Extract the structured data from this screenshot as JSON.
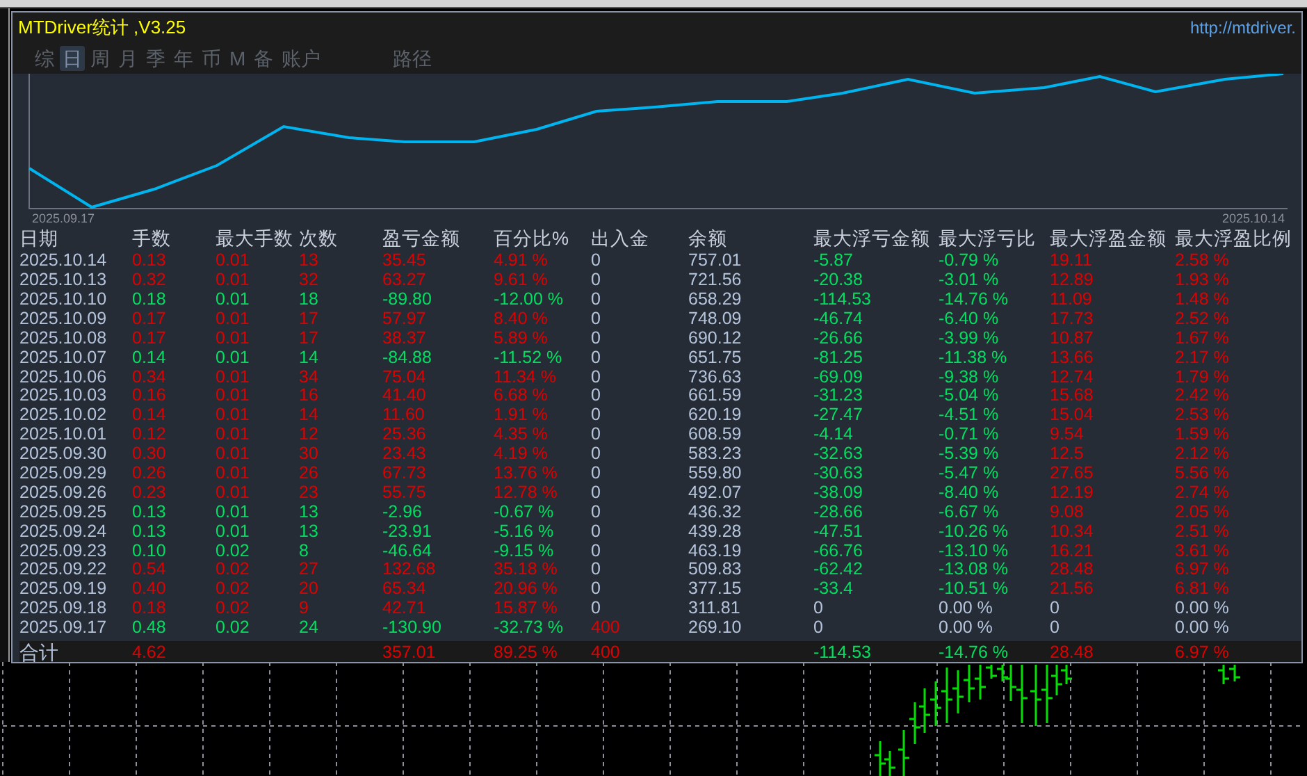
{
  "window": {
    "title": "MTDriver统计 ,V3.25",
    "link": "http://mtdriver."
  },
  "tabs": [
    {
      "label": "综",
      "selected": false
    },
    {
      "label": "日",
      "selected": true
    },
    {
      "label": "周",
      "selected": false
    },
    {
      "label": "月",
      "selected": false
    },
    {
      "label": "季",
      "selected": false
    },
    {
      "label": "年",
      "selected": false
    },
    {
      "label": "币",
      "selected": false
    },
    {
      "label": "M",
      "selected": false
    },
    {
      "label": "备",
      "selected": false
    },
    {
      "label": "账户",
      "selected": false
    },
    {
      "label": "路径",
      "selected": false
    }
  ],
  "balance_chart": {
    "start_label": "2025.09.17",
    "end_label": "2025.10.14"
  },
  "table": {
    "columns": [
      "日期",
      "手数",
      "最大手数",
      "次数",
      "盈亏金额",
      "百分比%",
      "出入金",
      "余额",
      "最大浮亏金额",
      "最大浮亏比",
      "最大浮盈金额",
      "最大浮盈比例"
    ],
    "rows": [
      {
        "cells": [
          {
            "text": "2025.10.14",
            "color": "#b4c4dc"
          },
          {
            "text": "0.13",
            "color": "#e00000"
          },
          {
            "text": "0.01",
            "color": "#e00000"
          },
          {
            "text": "13",
            "color": "#e00000"
          },
          {
            "text": "35.45",
            "color": "#e00000"
          },
          {
            "text": "4.91 %",
            "color": "#e00000"
          },
          {
            "text": "0",
            "color": "#b4c4dc"
          },
          {
            "text": "757.01",
            "color": "#b4c4dc"
          },
          {
            "text": "-5.87",
            "color": "#00e060"
          },
          {
            "text": "-0.79 %",
            "color": "#00e060"
          },
          {
            "text": "19.11",
            "color": "#e00000"
          },
          {
            "text": "2.58 %",
            "color": "#e00000"
          }
        ]
      },
      {
        "cells": [
          {
            "text": "2025.10.13",
            "color": "#b4c4dc"
          },
          {
            "text": "0.32",
            "color": "#e00000"
          },
          {
            "text": "0.01",
            "color": "#e00000"
          },
          {
            "text": "32",
            "color": "#e00000"
          },
          {
            "text": "63.27",
            "color": "#e00000"
          },
          {
            "text": "9.61 %",
            "color": "#e00000"
          },
          {
            "text": "0",
            "color": "#b4c4dc"
          },
          {
            "text": "721.56",
            "color": "#b4c4dc"
          },
          {
            "text": "-20.38",
            "color": "#00e060"
          },
          {
            "text": "-3.01 %",
            "color": "#00e060"
          },
          {
            "text": "12.89",
            "color": "#e00000"
          },
          {
            "text": "1.93 %",
            "color": "#e00000"
          }
        ]
      },
      {
        "cells": [
          {
            "text": "2025.10.10",
            "color": "#b4c4dc"
          },
          {
            "text": "0.18",
            "color": "#00e060"
          },
          {
            "text": "0.01",
            "color": "#00e060"
          },
          {
            "text": "18",
            "color": "#00e060"
          },
          {
            "text": "-89.80",
            "color": "#00e060"
          },
          {
            "text": "-12.00 %",
            "color": "#00e060"
          },
          {
            "text": "0",
            "color": "#b4c4dc"
          },
          {
            "text": "658.29",
            "color": "#b4c4dc"
          },
          {
            "text": "-114.53",
            "color": "#00e060"
          },
          {
            "text": "-14.76 %",
            "color": "#00e060"
          },
          {
            "text": "11.09",
            "color": "#e00000"
          },
          {
            "text": "1.48 %",
            "color": "#e00000"
          }
        ]
      },
      {
        "cells": [
          {
            "text": "2025.10.09",
            "color": "#b4c4dc"
          },
          {
            "text": "0.17",
            "color": "#e00000"
          },
          {
            "text": "0.01",
            "color": "#e00000"
          },
          {
            "text": "17",
            "color": "#e00000"
          },
          {
            "text": "57.97",
            "color": "#e00000"
          },
          {
            "text": "8.40 %",
            "color": "#e00000"
          },
          {
            "text": "0",
            "color": "#b4c4dc"
          },
          {
            "text": "748.09",
            "color": "#b4c4dc"
          },
          {
            "text": "-46.74",
            "color": "#00e060"
          },
          {
            "text": "-6.40 %",
            "color": "#00e060"
          },
          {
            "text": "17.73",
            "color": "#e00000"
          },
          {
            "text": "2.52 %",
            "color": "#e00000"
          }
        ]
      },
      {
        "cells": [
          {
            "text": "2025.10.08",
            "color": "#b4c4dc"
          },
          {
            "text": "0.17",
            "color": "#e00000"
          },
          {
            "text": "0.01",
            "color": "#e00000"
          },
          {
            "text": "17",
            "color": "#e00000"
          },
          {
            "text": "38.37",
            "color": "#e00000"
          },
          {
            "text": "5.89 %",
            "color": "#e00000"
          },
          {
            "text": "0",
            "color": "#b4c4dc"
          },
          {
            "text": "690.12",
            "color": "#b4c4dc"
          },
          {
            "text": "-26.66",
            "color": "#00e060"
          },
          {
            "text": "-3.99 %",
            "color": "#00e060"
          },
          {
            "text": "10.87",
            "color": "#e00000"
          },
          {
            "text": "1.67 %",
            "color": "#e00000"
          }
        ]
      },
      {
        "cells": [
          {
            "text": "2025.10.07",
            "color": "#b4c4dc"
          },
          {
            "text": "0.14",
            "color": "#00e060"
          },
          {
            "text": "0.01",
            "color": "#00e060"
          },
          {
            "text": "14",
            "color": "#00e060"
          },
          {
            "text": "-84.88",
            "color": "#00e060"
          },
          {
            "text": "-11.52 %",
            "color": "#00e060"
          },
          {
            "text": "0",
            "color": "#b4c4dc"
          },
          {
            "text": "651.75",
            "color": "#b4c4dc"
          },
          {
            "text": "-81.25",
            "color": "#00e060"
          },
          {
            "text": "-11.38 %",
            "color": "#00e060"
          },
          {
            "text": "13.66",
            "color": "#e00000"
          },
          {
            "text": "2.17 %",
            "color": "#e00000"
          }
        ]
      },
      {
        "cells": [
          {
            "text": "2025.10.06",
            "color": "#b4c4dc"
          },
          {
            "text": "0.34",
            "color": "#e00000"
          },
          {
            "text": "0.01",
            "color": "#e00000"
          },
          {
            "text": "34",
            "color": "#e00000"
          },
          {
            "text": "75.04",
            "color": "#e00000"
          },
          {
            "text": "11.34 %",
            "color": "#e00000"
          },
          {
            "text": "0",
            "color": "#b4c4dc"
          },
          {
            "text": "736.63",
            "color": "#b4c4dc"
          },
          {
            "text": "-69.09",
            "color": "#00e060"
          },
          {
            "text": "-9.38 %",
            "color": "#00e060"
          },
          {
            "text": "12.74",
            "color": "#e00000"
          },
          {
            "text": "1.79 %",
            "color": "#e00000"
          }
        ]
      },
      {
        "cells": [
          {
            "text": "2025.10.03",
            "color": "#b4c4dc"
          },
          {
            "text": "0.16",
            "color": "#e00000"
          },
          {
            "text": "0.01",
            "color": "#e00000"
          },
          {
            "text": "16",
            "color": "#e00000"
          },
          {
            "text": "41.40",
            "color": "#e00000"
          },
          {
            "text": "6.68 %",
            "color": "#e00000"
          },
          {
            "text": "0",
            "color": "#b4c4dc"
          },
          {
            "text": "661.59",
            "color": "#b4c4dc"
          },
          {
            "text": "-31.23",
            "color": "#00e060"
          },
          {
            "text": "-5.04 %",
            "color": "#00e060"
          },
          {
            "text": "15.68",
            "color": "#e00000"
          },
          {
            "text": "2.42 %",
            "color": "#e00000"
          }
        ]
      },
      {
        "cells": [
          {
            "text": "2025.10.02",
            "color": "#b4c4dc"
          },
          {
            "text": "0.14",
            "color": "#e00000"
          },
          {
            "text": "0.01",
            "color": "#e00000"
          },
          {
            "text": "14",
            "color": "#e00000"
          },
          {
            "text": "11.60",
            "color": "#e00000"
          },
          {
            "text": "1.91 %",
            "color": "#e00000"
          },
          {
            "text": "0",
            "color": "#b4c4dc"
          },
          {
            "text": "620.19",
            "color": "#b4c4dc"
          },
          {
            "text": "-27.47",
            "color": "#00e060"
          },
          {
            "text": "-4.51 %",
            "color": "#00e060"
          },
          {
            "text": "15.04",
            "color": "#e00000"
          },
          {
            "text": "2.53 %",
            "color": "#e00000"
          }
        ]
      },
      {
        "cells": [
          {
            "text": "2025.10.01",
            "color": "#b4c4dc"
          },
          {
            "text": "0.12",
            "color": "#e00000"
          },
          {
            "text": "0.01",
            "color": "#e00000"
          },
          {
            "text": "12",
            "color": "#e00000"
          },
          {
            "text": "25.36",
            "color": "#e00000"
          },
          {
            "text": "4.35 %",
            "color": "#e00000"
          },
          {
            "text": "0",
            "color": "#b4c4dc"
          },
          {
            "text": "608.59",
            "color": "#b4c4dc"
          },
          {
            "text": "-4.14",
            "color": "#00e060"
          },
          {
            "text": "-0.71 %",
            "color": "#00e060"
          },
          {
            "text": "9.54",
            "color": "#e00000"
          },
          {
            "text": "1.59 %",
            "color": "#e00000"
          }
        ]
      },
      {
        "cells": [
          {
            "text": "2025.09.30",
            "color": "#b4c4dc"
          },
          {
            "text": "0.30",
            "color": "#e00000"
          },
          {
            "text": "0.01",
            "color": "#e00000"
          },
          {
            "text": "30",
            "color": "#e00000"
          },
          {
            "text": "23.43",
            "color": "#e00000"
          },
          {
            "text": "4.19 %",
            "color": "#e00000"
          },
          {
            "text": "0",
            "color": "#b4c4dc"
          },
          {
            "text": "583.23",
            "color": "#b4c4dc"
          },
          {
            "text": "-32.63",
            "color": "#00e060"
          },
          {
            "text": "-5.39 %",
            "color": "#00e060"
          },
          {
            "text": "12.5",
            "color": "#e00000"
          },
          {
            "text": "2.12 %",
            "color": "#e00000"
          }
        ]
      },
      {
        "cells": [
          {
            "text": "2025.09.29",
            "color": "#b4c4dc"
          },
          {
            "text": "0.26",
            "color": "#e00000"
          },
          {
            "text": "0.01",
            "color": "#e00000"
          },
          {
            "text": "26",
            "color": "#e00000"
          },
          {
            "text": "67.73",
            "color": "#e00000"
          },
          {
            "text": "13.76 %",
            "color": "#e00000"
          },
          {
            "text": "0",
            "color": "#b4c4dc"
          },
          {
            "text": "559.80",
            "color": "#b4c4dc"
          },
          {
            "text": "-30.63",
            "color": "#00e060"
          },
          {
            "text": "-5.47 %",
            "color": "#00e060"
          },
          {
            "text": "27.65",
            "color": "#e00000"
          },
          {
            "text": "5.56 %",
            "color": "#e00000"
          }
        ]
      },
      {
        "cells": [
          {
            "text": "2025.09.26",
            "color": "#b4c4dc"
          },
          {
            "text": "0.23",
            "color": "#e00000"
          },
          {
            "text": "0.01",
            "color": "#e00000"
          },
          {
            "text": "23",
            "color": "#e00000"
          },
          {
            "text": "55.75",
            "color": "#e00000"
          },
          {
            "text": "12.78 %",
            "color": "#e00000"
          },
          {
            "text": "0",
            "color": "#b4c4dc"
          },
          {
            "text": "492.07",
            "color": "#b4c4dc"
          },
          {
            "text": "-38.09",
            "color": "#00e060"
          },
          {
            "text": "-8.40 %",
            "color": "#00e060"
          },
          {
            "text": "12.19",
            "color": "#e00000"
          },
          {
            "text": "2.74 %",
            "color": "#e00000"
          }
        ]
      },
      {
        "cells": [
          {
            "text": "2025.09.25",
            "color": "#b4c4dc"
          },
          {
            "text": "0.13",
            "color": "#00e060"
          },
          {
            "text": "0.01",
            "color": "#00e060"
          },
          {
            "text": "13",
            "color": "#00e060"
          },
          {
            "text": "-2.96",
            "color": "#00e060"
          },
          {
            "text": "-0.67 %",
            "color": "#00e060"
          },
          {
            "text": "0",
            "color": "#b4c4dc"
          },
          {
            "text": "436.32",
            "color": "#b4c4dc"
          },
          {
            "text": "-28.66",
            "color": "#00e060"
          },
          {
            "text": "-6.67 %",
            "color": "#00e060"
          },
          {
            "text": "9.08",
            "color": "#e00000"
          },
          {
            "text": "2.05 %",
            "color": "#e00000"
          }
        ]
      },
      {
        "cells": [
          {
            "text": "2025.09.24",
            "color": "#b4c4dc"
          },
          {
            "text": "0.13",
            "color": "#00e060"
          },
          {
            "text": "0.01",
            "color": "#00e060"
          },
          {
            "text": "13",
            "color": "#00e060"
          },
          {
            "text": "-23.91",
            "color": "#00e060"
          },
          {
            "text": "-5.16 %",
            "color": "#00e060"
          },
          {
            "text": "0",
            "color": "#b4c4dc"
          },
          {
            "text": "439.28",
            "color": "#b4c4dc"
          },
          {
            "text": "-47.51",
            "color": "#00e060"
          },
          {
            "text": "-10.26 %",
            "color": "#00e060"
          },
          {
            "text": "10.34",
            "color": "#e00000"
          },
          {
            "text": "2.51 %",
            "color": "#e00000"
          }
        ]
      },
      {
        "cells": [
          {
            "text": "2025.09.23",
            "color": "#b4c4dc"
          },
          {
            "text": "0.10",
            "color": "#00e060"
          },
          {
            "text": "0.02",
            "color": "#00e060"
          },
          {
            "text": "8",
            "color": "#00e060"
          },
          {
            "text": "-46.64",
            "color": "#00e060"
          },
          {
            "text": "-9.15 %",
            "color": "#00e060"
          },
          {
            "text": "0",
            "color": "#b4c4dc"
          },
          {
            "text": "463.19",
            "color": "#b4c4dc"
          },
          {
            "text": "-66.76",
            "color": "#00e060"
          },
          {
            "text": "-13.10 %",
            "color": "#00e060"
          },
          {
            "text": "16.21",
            "color": "#e00000"
          },
          {
            "text": "3.61 %",
            "color": "#e00000"
          }
        ]
      },
      {
        "cells": [
          {
            "text": "2025.09.22",
            "color": "#b4c4dc"
          },
          {
            "text": "0.54",
            "color": "#e00000"
          },
          {
            "text": "0.02",
            "color": "#e00000"
          },
          {
            "text": "27",
            "color": "#e00000"
          },
          {
            "text": "132.68",
            "color": "#e00000"
          },
          {
            "text": "35.18 %",
            "color": "#e00000"
          },
          {
            "text": "0",
            "color": "#b4c4dc"
          },
          {
            "text": "509.83",
            "color": "#b4c4dc"
          },
          {
            "text": "-62.42",
            "color": "#00e060"
          },
          {
            "text": "-13.08 %",
            "color": "#00e060"
          },
          {
            "text": "28.48",
            "color": "#e00000"
          },
          {
            "text": "6.97 %",
            "color": "#e00000"
          }
        ]
      },
      {
        "cells": [
          {
            "text": "2025.09.19",
            "color": "#b4c4dc"
          },
          {
            "text": "0.40",
            "color": "#e00000"
          },
          {
            "text": "0.02",
            "color": "#e00000"
          },
          {
            "text": "20",
            "color": "#e00000"
          },
          {
            "text": "65.34",
            "color": "#e00000"
          },
          {
            "text": "20.96 %",
            "color": "#e00000"
          },
          {
            "text": "0",
            "color": "#b4c4dc"
          },
          {
            "text": "377.15",
            "color": "#b4c4dc"
          },
          {
            "text": "-33.4",
            "color": "#00e060"
          },
          {
            "text": "-10.51 %",
            "color": "#00e060"
          },
          {
            "text": "21.56",
            "color": "#e00000"
          },
          {
            "text": "6.81 %",
            "color": "#e00000"
          }
        ]
      },
      {
        "cells": [
          {
            "text": "2025.09.18",
            "color": "#b4c4dc"
          },
          {
            "text": "0.18",
            "color": "#e00000"
          },
          {
            "text": "0.02",
            "color": "#e00000"
          },
          {
            "text": "9",
            "color": "#e00000"
          },
          {
            "text": "42.71",
            "color": "#e00000"
          },
          {
            "text": "15.87 %",
            "color": "#e00000"
          },
          {
            "text": "0",
            "color": "#b4c4dc"
          },
          {
            "text": "311.81",
            "color": "#b4c4dc"
          },
          {
            "text": "0",
            "color": "#b4c4dc"
          },
          {
            "text": "0.00 %",
            "color": "#b4c4dc"
          },
          {
            "text": "0",
            "color": "#b4c4dc"
          },
          {
            "text": "0.00 %",
            "color": "#b4c4dc"
          }
        ]
      },
      {
        "cells": [
          {
            "text": "2025.09.17",
            "color": "#b4c4dc"
          },
          {
            "text": "0.48",
            "color": "#00e060"
          },
          {
            "text": "0.02",
            "color": "#00e060"
          },
          {
            "text": "24",
            "color": "#00e060"
          },
          {
            "text": "-130.90",
            "color": "#00e060"
          },
          {
            "text": "-32.73 %",
            "color": "#00e060"
          },
          {
            "text": "400",
            "color": "#e00000"
          },
          {
            "text": "269.10",
            "color": "#b4c4dc"
          },
          {
            "text": "0",
            "color": "#b4c4dc"
          },
          {
            "text": "0.00 %",
            "color": "#b4c4dc"
          },
          {
            "text": "0",
            "color": "#b4c4dc"
          },
          {
            "text": "0.00 %",
            "color": "#b4c4dc"
          }
        ]
      }
    ],
    "total": {
      "cells": [
        {
          "text": "合计",
          "color": "#b4c4dc"
        },
        {
          "text": "4.62",
          "color": "#e00000"
        },
        null,
        null,
        {
          "text": "357.01",
          "color": "#e00000"
        },
        {
          "text": "89.25 %",
          "color": "#e00000"
        },
        {
          "text": "400",
          "color": "#e00000"
        },
        null,
        {
          "text": "-114.53",
          "color": "#00e060"
        },
        {
          "text": "-14.76 %",
          "color": "#00e060"
        },
        {
          "text": "28.48",
          "color": "#e00000"
        },
        {
          "text": "6.97 %",
          "color": "#e00000"
        }
      ]
    }
  }
}
